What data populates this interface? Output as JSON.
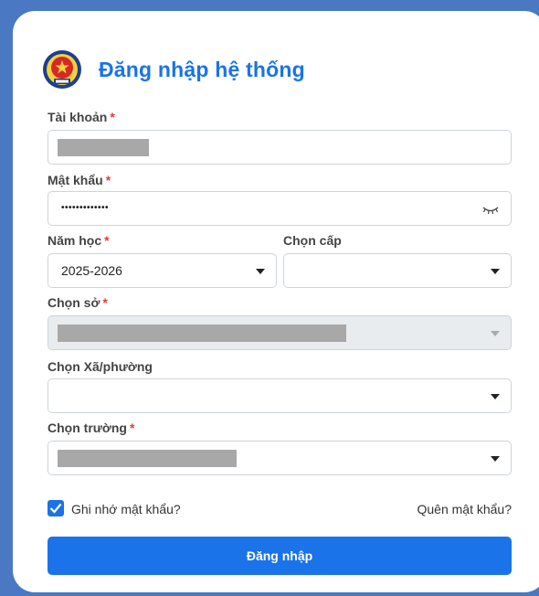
{
  "title": "Đăng nhập hệ thống",
  "required_mark": "*",
  "account": {
    "label": "Tài khoản"
  },
  "password": {
    "label": "Mật khẩu",
    "masked_value": "•••••••••••••"
  },
  "school_year": {
    "label": "Năm học",
    "value": "2025-2026"
  },
  "level": {
    "label": "Chọn cấp",
    "value": ""
  },
  "department": {
    "label": "Chọn sở"
  },
  "ward": {
    "label": "Chọn Xã/phường",
    "value": ""
  },
  "school": {
    "label": "Chọn trường"
  },
  "remember": {
    "label": "Ghi nhớ mật khẩu?",
    "checked": true
  },
  "forgot": {
    "label": "Quên mật khẩu?"
  },
  "submit": {
    "label": "Đăng nhập"
  },
  "colors": {
    "primary": "#1a73e8",
    "background": "#4a78c2",
    "required": "#e23b3b"
  },
  "icons": [
    "school-emblem-icon",
    "eye-closed-icon",
    "chevron-down-icon",
    "checkbox-checked-icon"
  ]
}
